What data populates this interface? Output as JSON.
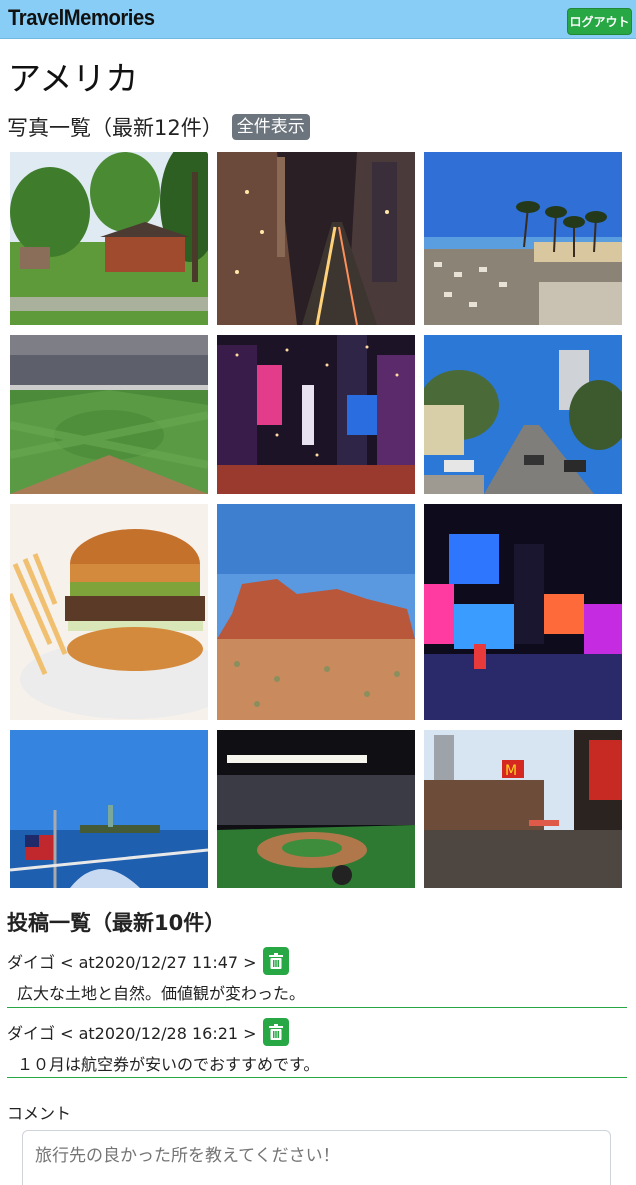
{
  "navbar": {
    "brand": "TravelMemories",
    "logout_label": "ログアウト"
  },
  "page": {
    "title": "アメリカ"
  },
  "photos": {
    "heading": "写真一覧（最新12件）",
    "show_all_label": "全件表示",
    "items": [
      {
        "name": "suburban-house-photo"
      },
      {
        "name": "city-street-night-photo"
      },
      {
        "name": "beach-parking-palms-photo"
      },
      {
        "name": "baseball-stadium-photo"
      },
      {
        "name": "times-square-confetti-photo"
      },
      {
        "name": "san-francisco-street-photo"
      },
      {
        "name": "hamburger-fries-photo"
      },
      {
        "name": "monument-valley-photo"
      },
      {
        "name": "times-square-night-photo"
      },
      {
        "name": "statue-of-liberty-boat-photo"
      },
      {
        "name": "stadium-night-game-photo"
      },
      {
        "name": "street-mcdonalds-photo"
      }
    ]
  },
  "posts": {
    "heading": "投稿一覧（最新10件）",
    "items": [
      {
        "meta": "ダイゴ < at2020/12/27 11:47 >",
        "body": "広大な土地と自然。価値観が変わった。"
      },
      {
        "meta": "ダイゴ < at2020/12/28 16:21 >",
        "body": "１０月は航空券が安いのでおすすめです。"
      }
    ]
  },
  "comment": {
    "label": "コメント",
    "placeholder": "旅行先の良かった所を教えてください！"
  }
}
